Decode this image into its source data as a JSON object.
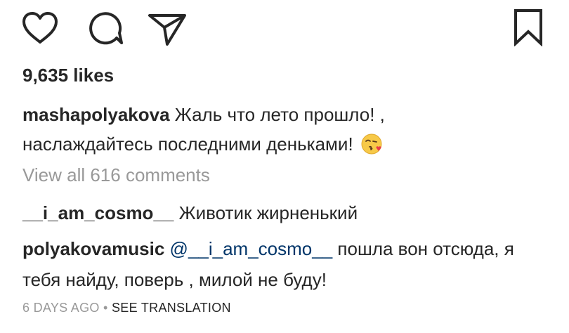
{
  "actions": {
    "like_icon": "heart-outline",
    "comment_icon": "speech-bubble-outline",
    "share_icon": "paper-plane-outline",
    "save_icon": "bookmark-outline"
  },
  "likes": "9,635 likes",
  "caption": {
    "username": "mashapolyakova",
    "text_line1": "Жаль что лето прошло! ,",
    "text_line2": "наслаждайтесь последними деньками!",
    "emoji": "kissing-face-emoji"
  },
  "view_all": "View all 616 comments",
  "comments": [
    {
      "username": "__i_am_cosmo__",
      "text": "Животик жирненький"
    },
    {
      "username": "polyakovamusic",
      "mention": "@__i_am_cosmo__",
      "text": "пошла вон отсюда, я тебя найду, поверь , милой не буду!"
    }
  ],
  "meta": {
    "time": "6 DAYS AGO",
    "separator": "•",
    "see_translation": "SEE TRANSLATION"
  }
}
